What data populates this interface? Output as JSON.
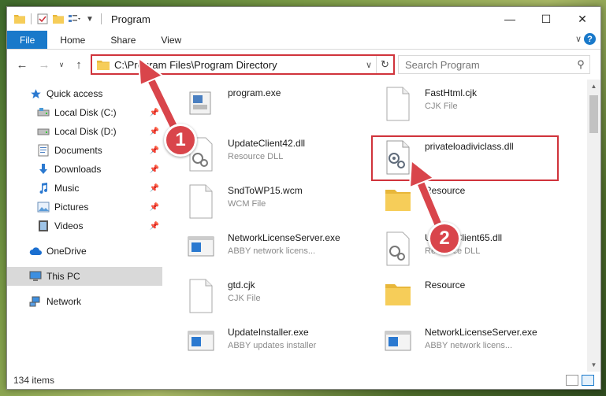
{
  "window": {
    "title": "Program"
  },
  "ribbon": {
    "tabs": [
      "File",
      "Home",
      "Share",
      "View"
    ]
  },
  "address": {
    "path": "C:\\Program Files\\Program Directory",
    "search_placeholder": "Search Program"
  },
  "sidebar": {
    "quick_access": "Quick access",
    "items": [
      {
        "label": "Local Disk (C:)",
        "icon": "drive-icon"
      },
      {
        "label": "Local Disk (D:)",
        "icon": "drive-icon"
      },
      {
        "label": "Documents",
        "icon": "documents-icon"
      },
      {
        "label": "Downloads",
        "icon": "downloads-icon"
      },
      {
        "label": "Music",
        "icon": "music-icon"
      },
      {
        "label": "Pictures",
        "icon": "pictures-icon"
      },
      {
        "label": "Videos",
        "icon": "videos-icon"
      }
    ],
    "onedrive": "OneDrive",
    "this_pc": "This PC",
    "network": "Network"
  },
  "files": [
    {
      "name": "program.exe",
      "type": ""
    },
    {
      "name": "FastHtml.cjk",
      "type": "CJK File"
    },
    {
      "name": "UpdateClient42.dll",
      "type": "Resource DLL"
    },
    {
      "name": "privateloadiviclass.dll",
      "type": ""
    },
    {
      "name": "SndToWP15.wcm",
      "type": "WCM File"
    },
    {
      "name": "Resource",
      "type": ""
    },
    {
      "name": "NetworkLicenseServer.exe",
      "type": "ABBY network licens..."
    },
    {
      "name": "UpdateClient65.dll",
      "type": "Resource DLL"
    },
    {
      "name": "gtd.cjk",
      "type": "CJK File"
    },
    {
      "name": "Resource",
      "type": ""
    },
    {
      "name": "UpdateInstaller.exe",
      "type": "ABBY updates installer"
    },
    {
      "name": "NetworkLicenseServer.exe",
      "type": "ABBY network licens..."
    }
  ],
  "status": {
    "items": "134 items"
  },
  "annotations": {
    "step1": "1",
    "step2": "2"
  },
  "colors": {
    "accent": "#1979ca",
    "highlight": "#d0333b",
    "badge": "#d9454b"
  }
}
